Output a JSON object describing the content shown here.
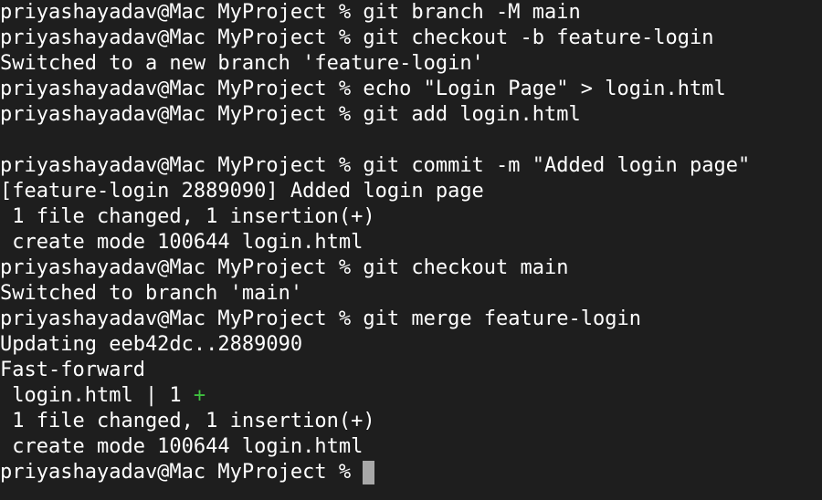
{
  "terminal": {
    "background_color": "#1e1e1e",
    "text_color": "#ffffff",
    "accent_green": "#3fbf3f",
    "cursor_color": "#a8a8a8",
    "lines": [
      "priyashayadav@Mac MyProject % git branch -M main",
      "priyashayadav@Mac MyProject % git checkout -b feature-login",
      "Switched to a new branch 'feature-login'",
      "priyashayadav@Mac MyProject % echo \"Login Page\" > login.html",
      "priyashayadav@Mac MyProject % git add login.html",
      "",
      "priyashayadav@Mac MyProject % git commit -m \"Added login page\"",
      "[feature-login 2889090] Added login page",
      " 1 file changed, 1 insertion(+)",
      " create mode 100644 login.html",
      "priyashayadav@Mac MyProject % git checkout main",
      "Switched to branch 'main'",
      "priyashayadav@Mac MyProject % git merge feature-login",
      "Updating eeb42dc..2889090",
      "Fast-forward"
    ],
    "diffstat": {
      "prefix": " login.html | 1 ",
      "plus": "+"
    },
    "lines_after": [
      " 1 file changed, 1 insertion(+)",
      " create mode 100644 login.html"
    ],
    "prompt": "priyashayadav@Mac MyProject % "
  }
}
